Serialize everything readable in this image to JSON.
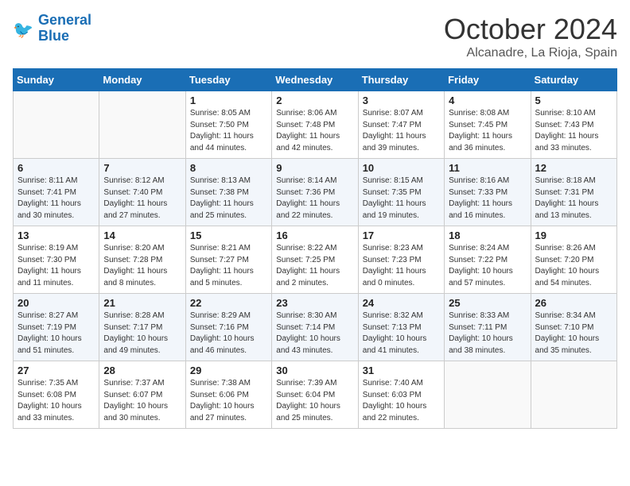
{
  "logo": {
    "line1": "General",
    "line2": "Blue"
  },
  "title": "October 2024",
  "location": "Alcanadre, La Rioja, Spain",
  "days_of_week": [
    "Sunday",
    "Monday",
    "Tuesday",
    "Wednesday",
    "Thursday",
    "Friday",
    "Saturday"
  ],
  "weeks": [
    [
      {
        "day": "",
        "sunrise": "",
        "sunset": "",
        "daylight": ""
      },
      {
        "day": "",
        "sunrise": "",
        "sunset": "",
        "daylight": ""
      },
      {
        "day": "1",
        "sunrise": "Sunrise: 8:05 AM",
        "sunset": "Sunset: 7:50 PM",
        "daylight": "Daylight: 11 hours and 44 minutes."
      },
      {
        "day": "2",
        "sunrise": "Sunrise: 8:06 AM",
        "sunset": "Sunset: 7:48 PM",
        "daylight": "Daylight: 11 hours and 42 minutes."
      },
      {
        "day": "3",
        "sunrise": "Sunrise: 8:07 AM",
        "sunset": "Sunset: 7:47 PM",
        "daylight": "Daylight: 11 hours and 39 minutes."
      },
      {
        "day": "4",
        "sunrise": "Sunrise: 8:08 AM",
        "sunset": "Sunset: 7:45 PM",
        "daylight": "Daylight: 11 hours and 36 minutes."
      },
      {
        "day": "5",
        "sunrise": "Sunrise: 8:10 AM",
        "sunset": "Sunset: 7:43 PM",
        "daylight": "Daylight: 11 hours and 33 minutes."
      }
    ],
    [
      {
        "day": "6",
        "sunrise": "Sunrise: 8:11 AM",
        "sunset": "Sunset: 7:41 PM",
        "daylight": "Daylight: 11 hours and 30 minutes."
      },
      {
        "day": "7",
        "sunrise": "Sunrise: 8:12 AM",
        "sunset": "Sunset: 7:40 PM",
        "daylight": "Daylight: 11 hours and 27 minutes."
      },
      {
        "day": "8",
        "sunrise": "Sunrise: 8:13 AM",
        "sunset": "Sunset: 7:38 PM",
        "daylight": "Daylight: 11 hours and 25 minutes."
      },
      {
        "day": "9",
        "sunrise": "Sunrise: 8:14 AM",
        "sunset": "Sunset: 7:36 PM",
        "daylight": "Daylight: 11 hours and 22 minutes."
      },
      {
        "day": "10",
        "sunrise": "Sunrise: 8:15 AM",
        "sunset": "Sunset: 7:35 PM",
        "daylight": "Daylight: 11 hours and 19 minutes."
      },
      {
        "day": "11",
        "sunrise": "Sunrise: 8:16 AM",
        "sunset": "Sunset: 7:33 PM",
        "daylight": "Daylight: 11 hours and 16 minutes."
      },
      {
        "day": "12",
        "sunrise": "Sunrise: 8:18 AM",
        "sunset": "Sunset: 7:31 PM",
        "daylight": "Daylight: 11 hours and 13 minutes."
      }
    ],
    [
      {
        "day": "13",
        "sunrise": "Sunrise: 8:19 AM",
        "sunset": "Sunset: 7:30 PM",
        "daylight": "Daylight: 11 hours and 11 minutes."
      },
      {
        "day": "14",
        "sunrise": "Sunrise: 8:20 AM",
        "sunset": "Sunset: 7:28 PM",
        "daylight": "Daylight: 11 hours and 8 minutes."
      },
      {
        "day": "15",
        "sunrise": "Sunrise: 8:21 AM",
        "sunset": "Sunset: 7:27 PM",
        "daylight": "Daylight: 11 hours and 5 minutes."
      },
      {
        "day": "16",
        "sunrise": "Sunrise: 8:22 AM",
        "sunset": "Sunset: 7:25 PM",
        "daylight": "Daylight: 11 hours and 2 minutes."
      },
      {
        "day": "17",
        "sunrise": "Sunrise: 8:23 AM",
        "sunset": "Sunset: 7:23 PM",
        "daylight": "Daylight: 11 hours and 0 minutes."
      },
      {
        "day": "18",
        "sunrise": "Sunrise: 8:24 AM",
        "sunset": "Sunset: 7:22 PM",
        "daylight": "Daylight: 10 hours and 57 minutes."
      },
      {
        "day": "19",
        "sunrise": "Sunrise: 8:26 AM",
        "sunset": "Sunset: 7:20 PM",
        "daylight": "Daylight: 10 hours and 54 minutes."
      }
    ],
    [
      {
        "day": "20",
        "sunrise": "Sunrise: 8:27 AM",
        "sunset": "Sunset: 7:19 PM",
        "daylight": "Daylight: 10 hours and 51 minutes."
      },
      {
        "day": "21",
        "sunrise": "Sunrise: 8:28 AM",
        "sunset": "Sunset: 7:17 PM",
        "daylight": "Daylight: 10 hours and 49 minutes."
      },
      {
        "day": "22",
        "sunrise": "Sunrise: 8:29 AM",
        "sunset": "Sunset: 7:16 PM",
        "daylight": "Daylight: 10 hours and 46 minutes."
      },
      {
        "day": "23",
        "sunrise": "Sunrise: 8:30 AM",
        "sunset": "Sunset: 7:14 PM",
        "daylight": "Daylight: 10 hours and 43 minutes."
      },
      {
        "day": "24",
        "sunrise": "Sunrise: 8:32 AM",
        "sunset": "Sunset: 7:13 PM",
        "daylight": "Daylight: 10 hours and 41 minutes."
      },
      {
        "day": "25",
        "sunrise": "Sunrise: 8:33 AM",
        "sunset": "Sunset: 7:11 PM",
        "daylight": "Daylight: 10 hours and 38 minutes."
      },
      {
        "day": "26",
        "sunrise": "Sunrise: 8:34 AM",
        "sunset": "Sunset: 7:10 PM",
        "daylight": "Daylight: 10 hours and 35 minutes."
      }
    ],
    [
      {
        "day": "27",
        "sunrise": "Sunrise: 7:35 AM",
        "sunset": "Sunset: 6:08 PM",
        "daylight": "Daylight: 10 hours and 33 minutes."
      },
      {
        "day": "28",
        "sunrise": "Sunrise: 7:37 AM",
        "sunset": "Sunset: 6:07 PM",
        "daylight": "Daylight: 10 hours and 30 minutes."
      },
      {
        "day": "29",
        "sunrise": "Sunrise: 7:38 AM",
        "sunset": "Sunset: 6:06 PM",
        "daylight": "Daylight: 10 hours and 27 minutes."
      },
      {
        "day": "30",
        "sunrise": "Sunrise: 7:39 AM",
        "sunset": "Sunset: 6:04 PM",
        "daylight": "Daylight: 10 hours and 25 minutes."
      },
      {
        "day": "31",
        "sunrise": "Sunrise: 7:40 AM",
        "sunset": "Sunset: 6:03 PM",
        "daylight": "Daylight: 10 hours and 22 minutes."
      },
      {
        "day": "",
        "sunrise": "",
        "sunset": "",
        "daylight": ""
      },
      {
        "day": "",
        "sunrise": "",
        "sunset": "",
        "daylight": ""
      }
    ]
  ]
}
